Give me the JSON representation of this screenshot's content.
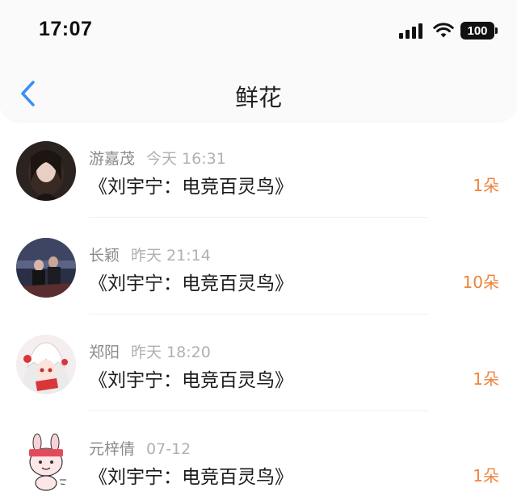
{
  "status_bar": {
    "time": "17:07",
    "battery": "100"
  },
  "header": {
    "title": "鲜花"
  },
  "items": [
    {
      "name": "游嘉茂",
      "time": "今天 16:31",
      "book": "《刘宇宁：电竞百灵鸟》",
      "count": "1朵"
    },
    {
      "name": "长颖",
      "time": "昨天 21:14",
      "book": "《刘宇宁：电竞百灵鸟》",
      "count": "10朵"
    },
    {
      "name": "郑阳",
      "time": "昨天 18:20",
      "book": "《刘宇宁：电竞百灵鸟》",
      "count": "1朵"
    },
    {
      "name": "元梓倩",
      "time": "07-12",
      "book": "《刘宇宁：电竞百灵鸟》",
      "count": "1朵"
    }
  ],
  "colors": {
    "accent": "#3b8ff0",
    "count": "#f0833a"
  }
}
